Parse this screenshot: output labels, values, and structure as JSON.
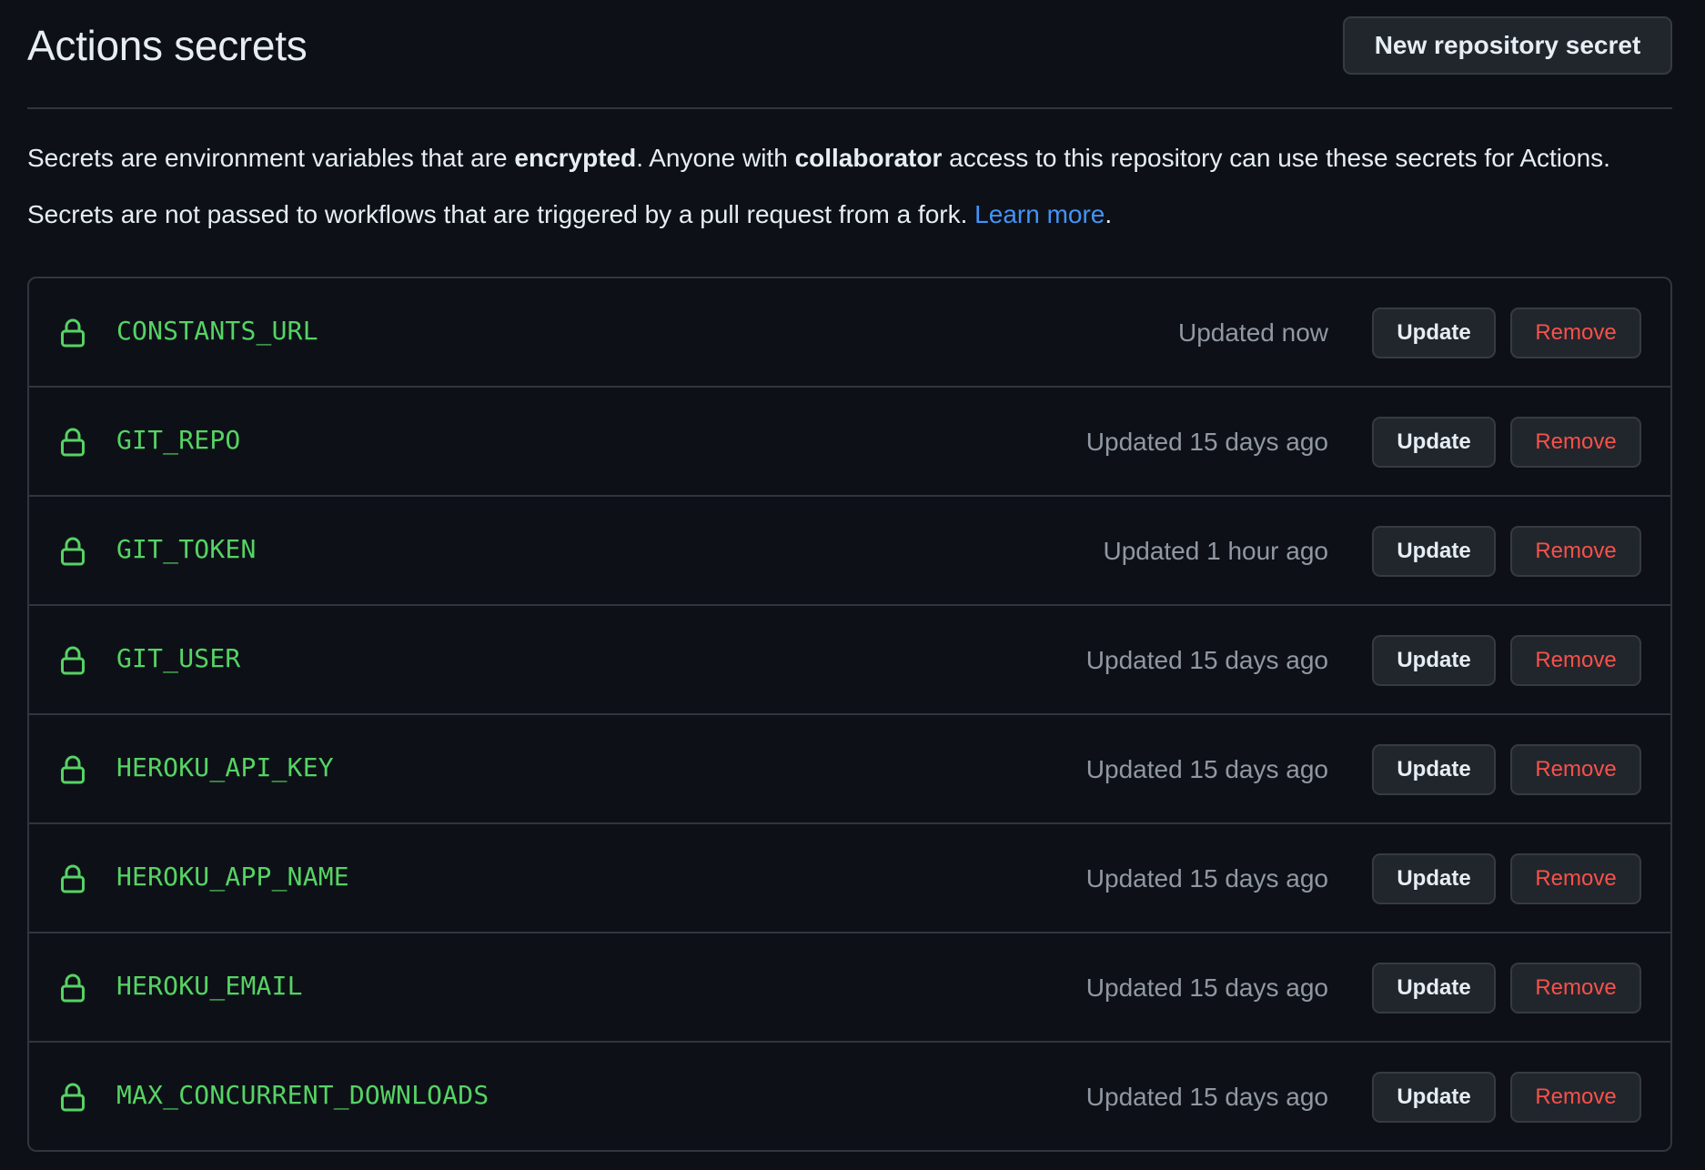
{
  "header": {
    "title": "Actions secrets",
    "new_secret_label": "New repository secret"
  },
  "description": {
    "line1": [
      {
        "text": "Secrets are environment variables that are ",
        "bold": false
      },
      {
        "text": "encrypted",
        "bold": true
      },
      {
        "text": ". Anyone with ",
        "bold": false
      },
      {
        "text": "collaborator",
        "bold": true
      },
      {
        "text": " access to this repository can use these secrets for Actions.",
        "bold": false
      }
    ],
    "line2_text": "Secrets are not passed to workflows that are triggered by a pull request from a fork. ",
    "learn_more": "Learn more",
    "line2_end": "."
  },
  "colors": {
    "background": "#0d1117",
    "secret_name": "#56d364",
    "link": "#4493f8",
    "danger": "#f85149",
    "muted": "#9198a1",
    "border": "#30363d"
  },
  "secrets": [
    {
      "name": "CONSTANTS_URL",
      "updated": "Updated now",
      "update_label": "Update",
      "remove_label": "Remove",
      "icon": "lock-icon"
    },
    {
      "name": "GIT_REPO",
      "updated": "Updated 15 days ago",
      "update_label": "Update",
      "remove_label": "Remove",
      "icon": "lock-icon"
    },
    {
      "name": "GIT_TOKEN",
      "updated": "Updated 1 hour ago",
      "update_label": "Update",
      "remove_label": "Remove",
      "icon": "lock-icon"
    },
    {
      "name": "GIT_USER",
      "updated": "Updated 15 days ago",
      "update_label": "Update",
      "remove_label": "Remove",
      "icon": "lock-icon"
    },
    {
      "name": "HEROKU_API_KEY",
      "updated": "Updated 15 days ago",
      "update_label": "Update",
      "remove_label": "Remove",
      "icon": "lock-icon"
    },
    {
      "name": "HEROKU_APP_NAME",
      "updated": "Updated 15 days ago",
      "update_label": "Update",
      "remove_label": "Remove",
      "icon": "lock-icon"
    },
    {
      "name": "HEROKU_EMAIL",
      "updated": "Updated 15 days ago",
      "update_label": "Update",
      "remove_label": "Remove",
      "icon": "lock-icon"
    },
    {
      "name": "MAX_CONCURRENT_DOWNLOADS",
      "updated": "Updated 15 days ago",
      "update_label": "Update",
      "remove_label": "Remove",
      "icon": "lock-icon"
    }
  ]
}
